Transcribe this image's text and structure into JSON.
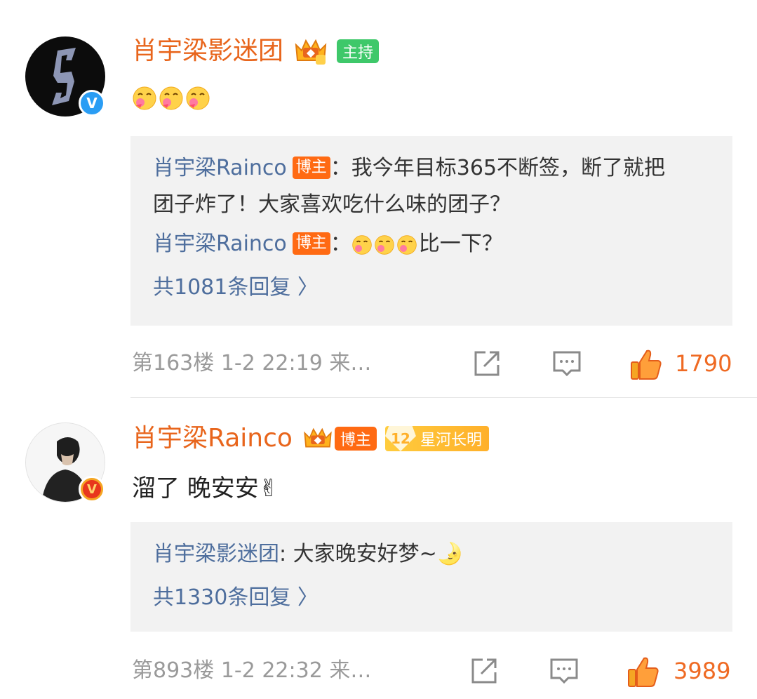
{
  "comments": [
    {
      "username": "肖宇梁影迷团",
      "badge": "主持",
      "content_text": "",
      "emoji_count": 3,
      "replies": [
        {
          "user": "肖宇梁Rainco",
          "tag": "博主",
          "text": "：我今年目标365不断签，断了就把",
          "text2": "团子炸了！大家喜欢吃什么味的团子？"
        },
        {
          "user": "肖宇梁Rainco",
          "tag": "博主",
          "text": "：",
          "text_after_emoji": "比一下？"
        }
      ],
      "more_replies": "共1081条回复 〉",
      "floor": "第163楼",
      "time": "1-2 22:19",
      "source": "来…",
      "likes": "1790"
    },
    {
      "username": "肖宇梁Rainco",
      "badge": "博主",
      "fan_level": "12",
      "fan_badge": "星河长明",
      "content_text": "溜了 晚安安✌",
      "replies": [
        {
          "user": "肖宇梁影迷团",
          "text": ": 大家晚安好梦~🌛"
        }
      ],
      "more_replies": "共1330条回复 〉",
      "floor": "第893楼",
      "time": "1-2 22:32",
      "source": "来…",
      "likes": "3989"
    }
  ],
  "icons": [
    "share-icon",
    "comment-icon",
    "like-icon",
    "verified-icon",
    "crown-icon"
  ],
  "colors": {
    "username": "#e8651c",
    "link": "#4e6e9d",
    "meta": "#9a9a9a",
    "like": "#ef6a23",
    "reply_bg": "#f2f2f2"
  }
}
